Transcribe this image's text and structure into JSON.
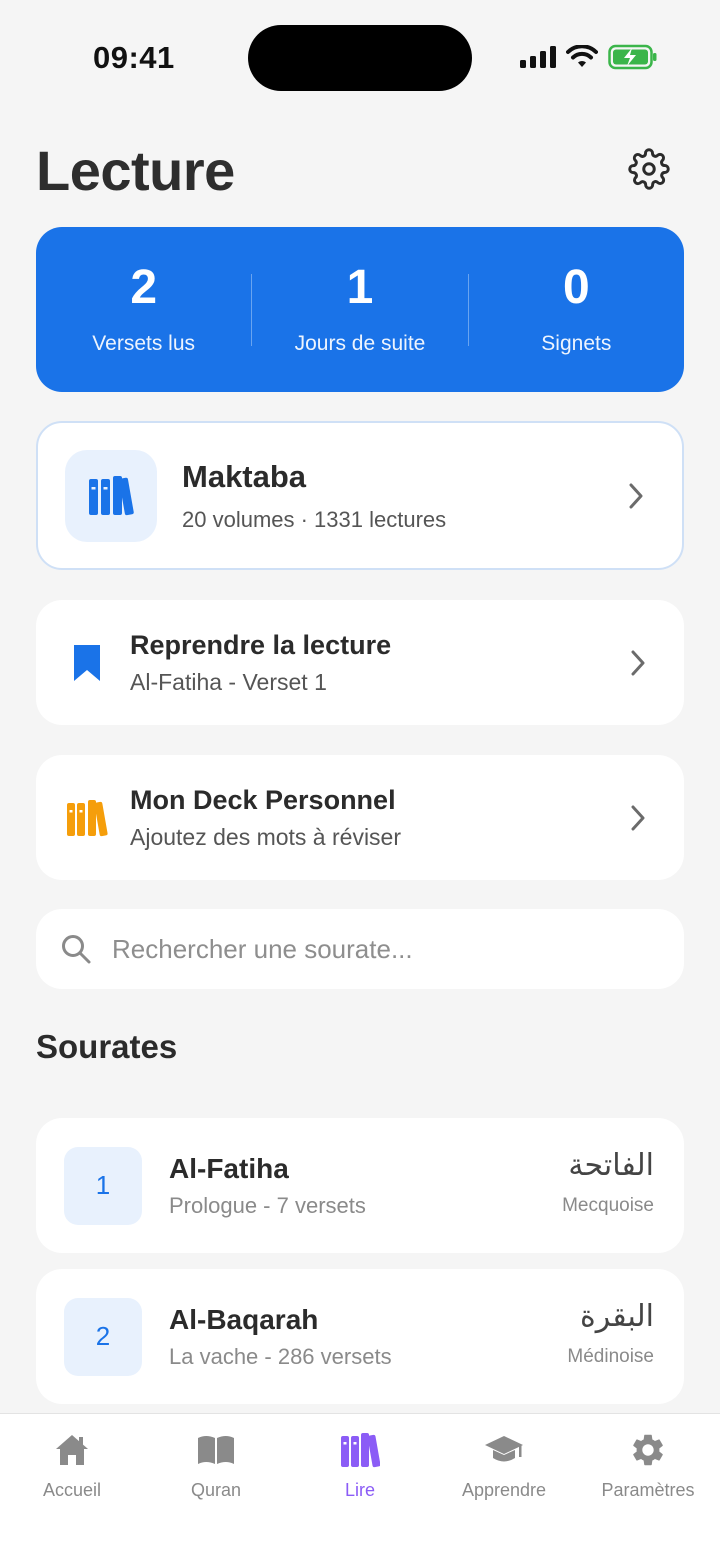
{
  "status_bar": {
    "time": "09:41"
  },
  "header": {
    "title": "Lecture"
  },
  "stats": [
    {
      "value": "2",
      "label": "Versets lus"
    },
    {
      "value": "1",
      "label": "Jours de suite"
    },
    {
      "value": "0",
      "label": "Signets"
    }
  ],
  "maktaba": {
    "title": "Maktaba",
    "subtitle": "20 volumes · 1331 lectures"
  },
  "resume": {
    "title": "Reprendre la lecture",
    "subtitle": "Al-Fatiha - Verset 1"
  },
  "deck": {
    "title": "Mon Deck Personnel",
    "subtitle": "Ajoutez des mots à réviser"
  },
  "search": {
    "placeholder": "Rechercher une sourate..."
  },
  "section_title": "Sourates",
  "surahs": [
    {
      "number": "1",
      "name": "Al-Fatiha",
      "subtitle": "Prologue - 7 versets",
      "arabic": "الفاتحة",
      "type": "Mecquoise"
    },
    {
      "number": "2",
      "name": "Al-Baqarah",
      "subtitle": "La vache - 286 versets",
      "arabic": "البقرة",
      "type": "Médinoise"
    }
  ],
  "tabs": [
    {
      "label": "Accueil",
      "icon": "home-icon"
    },
    {
      "label": "Quran",
      "icon": "book-icon"
    },
    {
      "label": "Lire",
      "icon": "books-icon",
      "active": true
    },
    {
      "label": "Apprendre",
      "icon": "graduation-cap-icon"
    },
    {
      "label": "Paramètres",
      "icon": "gear-icon"
    }
  ],
  "colors": {
    "primary": "#1a73e8",
    "active_tab": "#8b5cf6",
    "deck_accent": "#f59e0b",
    "background": "#f5f5f5"
  }
}
